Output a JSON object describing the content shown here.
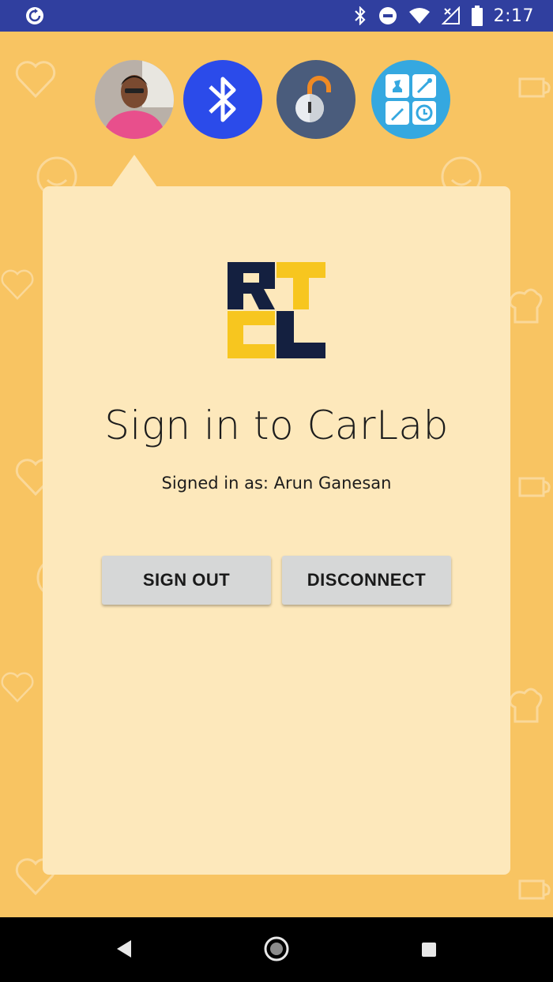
{
  "status_bar": {
    "time": "2:17",
    "left_icon": "sync-icon",
    "icons": [
      "bluetooth-icon",
      "do-not-disturb-icon",
      "wifi-icon",
      "no-signal-icon",
      "battery-icon"
    ]
  },
  "top_icons": [
    {
      "name": "profile-avatar"
    },
    {
      "name": "bluetooth-icon"
    },
    {
      "name": "unlock-icon"
    },
    {
      "name": "apps-grid-icon"
    }
  ],
  "logo": {
    "letters": [
      "R",
      "T",
      "C",
      "L"
    ],
    "colors": {
      "navy": "#142040",
      "gold": "#f7c61f"
    }
  },
  "title": "Sign in to CarLab",
  "subtitle": "Signed in as: Arun Ganesan",
  "buttons": {
    "sign_out": "SIGN OUT",
    "disconnect": "DISCONNECT"
  },
  "colors": {
    "status_bar": "#303f9f",
    "background": "#f8c462",
    "card": "#fde8bb",
    "button": "#d6d7d7"
  }
}
